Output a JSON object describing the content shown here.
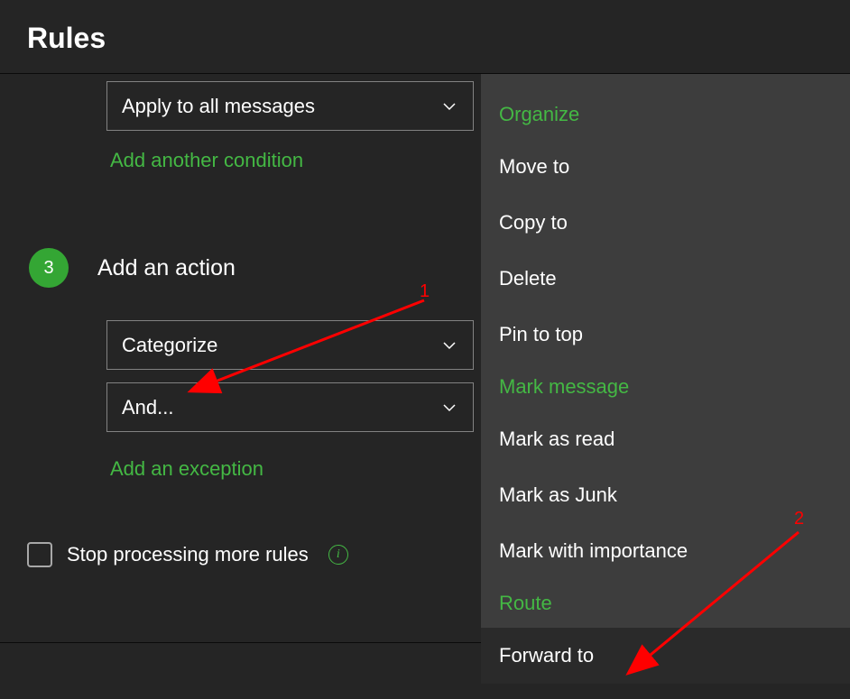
{
  "title": "Rules",
  "condition": {
    "selected": "Apply to all messages",
    "add_link": "Add another condition"
  },
  "step3": {
    "number": "3",
    "label": "Add an action"
  },
  "actions": {
    "dropdown1": "Categorize",
    "dropdown2": "And...",
    "exception_link": "Add an exception"
  },
  "stop_processing": {
    "label": "Stop processing more rules"
  },
  "menu": {
    "organize_header": "Organize",
    "move_to": "Move to",
    "copy_to": "Copy to",
    "delete": "Delete",
    "pin_to_top": "Pin to top",
    "mark_header": "Mark message",
    "mark_as_read": "Mark as read",
    "mark_as_junk": "Mark as Junk",
    "mark_importance": "Mark with importance",
    "route_header": "Route",
    "forward_to": "Forward to"
  },
  "annotations": {
    "one": "1",
    "two": "2"
  }
}
